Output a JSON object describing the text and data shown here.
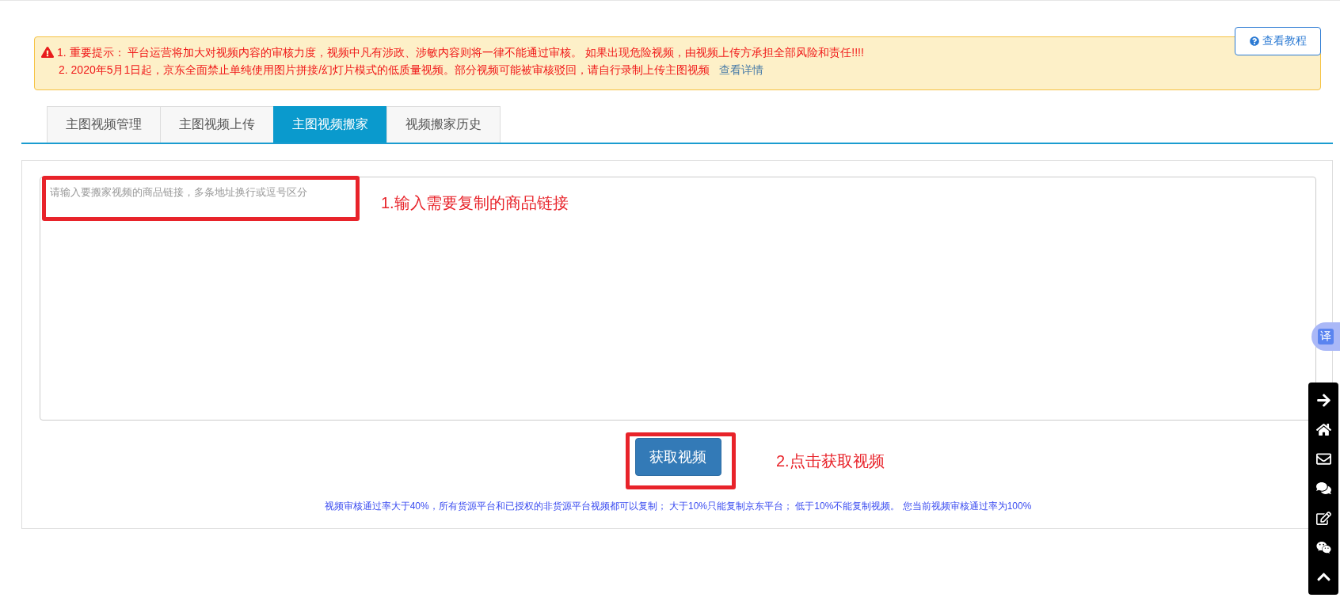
{
  "alert": {
    "line_1": "1. 重要提示：  平台运营将加大对视频内容的审核力度，视频中凡有涉政、涉敏内容则将一律不能通过审核。 如果出现危险视频，由视频上传方承担全部风险和责任!!!!",
    "line_2": "2. 2020年5月1日起，京东全面禁止单纯使用图片拼接/幻灯片模式的低质量视频。部分视频可能被审核驳回，请自行录制上传主图视频",
    "link": "查看详情"
  },
  "help_button": "查看教程",
  "tabs": [
    {
      "label": "主图视频管理",
      "selected": false
    },
    {
      "label": "主图视频上传",
      "selected": false
    },
    {
      "label": "主图视频搬家",
      "selected": true
    },
    {
      "label": "视频搬家历史",
      "selected": false
    }
  ],
  "textarea": {
    "placeholder": "请输入要搬家视频的商品链接，多条地址换行或逗号区分"
  },
  "annotations": [
    "1.输入需要复制的商品链接",
    "2.点击获取视频"
  ],
  "submit_button": "获取视频",
  "note": "视频审核通过率大于40%，所有货源平台和已授权的非货源平台视频都可以复制；  大于10%只能复制京东平台；  低于10%不能复制视频。  您当前视频审核通过率为100%",
  "translate_badge": "译"
}
